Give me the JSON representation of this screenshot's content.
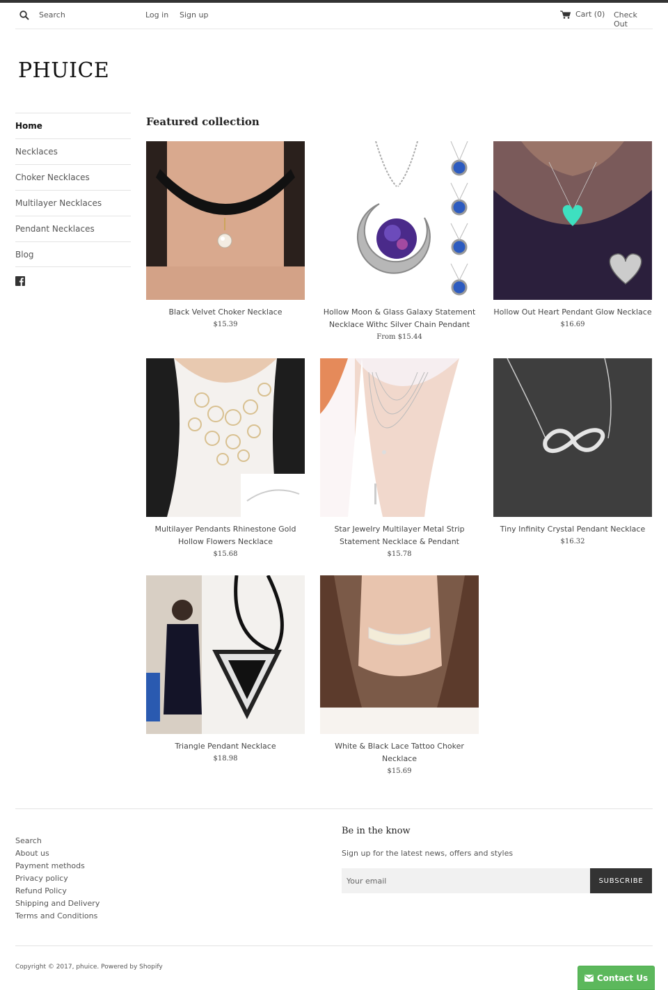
{
  "header": {
    "search_placeholder": "Search",
    "login": "Log in",
    "signup": "Sign up",
    "cart": "Cart (0)",
    "checkout": "Check Out"
  },
  "brand": {
    "logo": "PHUICE"
  },
  "sidebar": {
    "items": [
      {
        "label": "Home",
        "active": true
      },
      {
        "label": "Necklaces"
      },
      {
        "label": "Choker Necklaces"
      },
      {
        "label": "Multilayer Necklaces"
      },
      {
        "label": "Pendant Necklaces"
      },
      {
        "label": "Blog"
      }
    ],
    "social_icon": "facebook-icon"
  },
  "main": {
    "section_title": "Featured collection",
    "products": [
      {
        "name": "Black Velvet Choker Necklace",
        "price": "$15.39"
      },
      {
        "name": "Hollow Moon & Glass Galaxy Statement Necklace Withc Silver Chain Pendant",
        "price": "From $15.44"
      },
      {
        "name": "Hollow Out Heart Pendant Glow Necklace",
        "price": "$16.69"
      },
      {
        "name": "Multilayer Pendants Rhinestone Gold Hollow Flowers Necklace",
        "price": "$15.68"
      },
      {
        "name": "Star Jewelry Multilayer Metal Strip Statement Necklace & Pendant",
        "price": "$15.78"
      },
      {
        "name": "Tiny Infinity Crystal Pendant Necklace",
        "price": "$16.32"
      },
      {
        "name": "Triangle Pendant Necklace",
        "price": "$18.98"
      },
      {
        "name": "White & Black Lace Tattoo Choker Necklace",
        "price": "$15.69"
      }
    ]
  },
  "footer": {
    "links": [
      "Search",
      "About us",
      "Payment methods",
      "Privacy policy",
      "Refund Policy",
      "Shipping and Delivery",
      "Terms and Conditions"
    ],
    "newsletter_title": "Be in the know",
    "newsletter_text": "Sign up for the latest news, offers and styles",
    "email_placeholder": "Your email",
    "subscribe": "SUBSCRIBE",
    "copyright": "Copyright © 2017, phuice. Powered by Shopify",
    "contact": "Contact Us"
  }
}
